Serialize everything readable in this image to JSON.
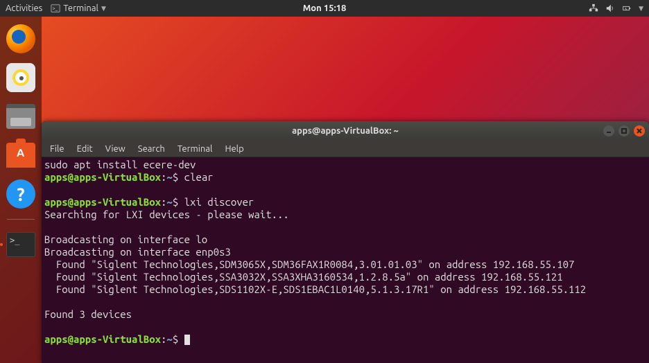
{
  "top_panel": {
    "activities": "Activities",
    "app_name": "Terminal",
    "clock": "Mon 15:18"
  },
  "terminal": {
    "title": "apps@apps-VirtualBox: ~",
    "menu": {
      "file": "File",
      "edit": "Edit",
      "view": "View",
      "search": "Search",
      "terminal": "Terminal",
      "help": "Help"
    },
    "prompt_user_host": "apps@apps-VirtualBox",
    "prompt_cwd": "~",
    "prompt_suffix": "$",
    "lines": {
      "l0": "sudo apt install ecere-dev",
      "cmd_clear": "clear",
      "cmd_lxi": "lxi discover",
      "searching": "Searching for LXI devices - please wait...",
      "bcast_lo": "Broadcasting on interface lo",
      "bcast_enp": "Broadcasting on interface enp0s3",
      "found1": "  Found \"Siglent Technologies,SDM3065X,SDM36FAX1R0084,3.01.01.03\" on address 192.168.55.107",
      "found2": "  Found \"Siglent Technologies,SSA3032X,SSA3XHA3160534,1.2.8.5a\" on address 192.168.55.121",
      "found3": "  Found \"Siglent Technologies,SDS1102X-E,SDS1EBAC1L0140,5.1.3.17R1\" on address 192.168.55.112",
      "found_count": "Found 3 devices"
    }
  }
}
